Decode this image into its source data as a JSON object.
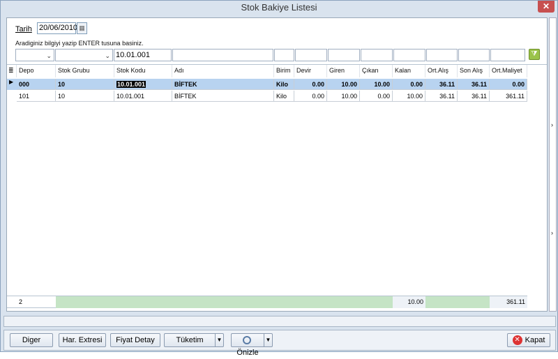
{
  "window": {
    "title": "Stok Bakiye Listesi",
    "close_glyph": "✕"
  },
  "filter": {
    "date_label": "Tarih",
    "date_value": "20/06/2010",
    "hint": "Aradiginiz bilgiyi yazip ENTER tusuna basiniz.",
    "stok_kodu_filter": "10.01.001"
  },
  "grid": {
    "columns": [
      "Depo",
      "Stok Grubu",
      "Stok Kodu",
      "Adı",
      "Birim",
      "Devir",
      "Giren",
      "Çıkan",
      "Kalan",
      "Ort.Alış",
      "Son Alış",
      "Ort.Maliyet"
    ],
    "rows": [
      [
        "000",
        "10",
        "10.01.001",
        "BİFTEK",
        "Kilo",
        "0.00",
        "10.00",
        "10.00",
        "0.00",
        "36.11",
        "36.11",
        "0.00"
      ],
      [
        "101",
        "10",
        "10.01.001",
        "BİFTEK",
        "Kilo",
        "0.00",
        "10.00",
        "0.00",
        "10.00",
        "36.11",
        "36.11",
        "361.11"
      ]
    ],
    "selected_row": 0,
    "footer": {
      "count": "2",
      "kalan_total": "10.00",
      "maliyet_total": "361.11"
    }
  },
  "buttons": {
    "diger": "Diger",
    "har_extresi": "Har. Extresi",
    "fiyat_detay": "Fiyat Detay",
    "tuketim": "Tüketim",
    "onizle": "Önizle",
    "kapat": "Kapat"
  },
  "icons": {
    "calendar": "calendar-icon",
    "filter": "filter-icon",
    "preview": "magnifier-icon",
    "close": "close-circle-icon"
  }
}
